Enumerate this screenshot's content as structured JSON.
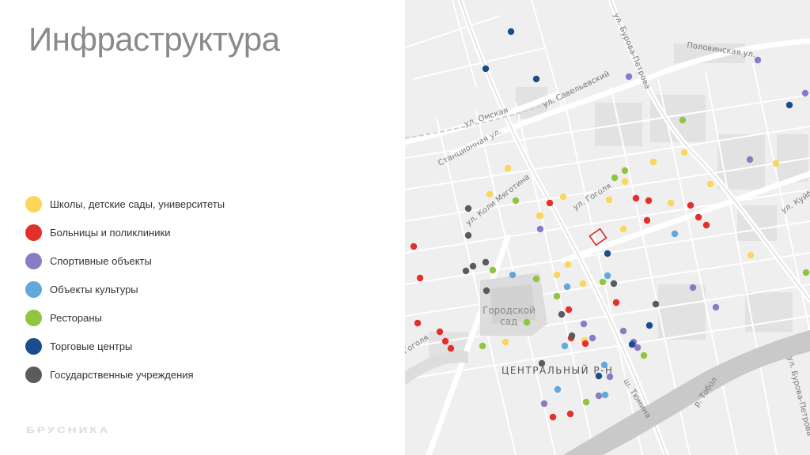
{
  "title": "Инфраструктура",
  "legend": [
    {
      "key": "school",
      "label": "Школы, детские сады, университеты",
      "color": "#fad75a"
    },
    {
      "key": "hospital",
      "label": "Больницы и поликлиники",
      "color": "#e2302b"
    },
    {
      "key": "sport",
      "label": "Спортивные объекты",
      "color": "#8a7cc4"
    },
    {
      "key": "culture",
      "label": "Объекты культуры",
      "color": "#62a8dc"
    },
    {
      "key": "restaurant",
      "label": "Рестораны",
      "color": "#8ec63f"
    },
    {
      "key": "mall",
      "label": "Торговые центры",
      "color": "#1a4c8e"
    },
    {
      "key": "gov",
      "label": "Государственные учреждения",
      "color": "#5b5b5b"
    }
  ],
  "brand": "БРУСНИКА",
  "map": {
    "streets": {
      "polovinskaya": "Половинская ул.",
      "burova_top": "ул. Бурова-Петрова",
      "saveleva": "ул. Савельевский",
      "omskaya": "ул. Омская",
      "stantsionnaya": "Станционная ул.",
      "gogolya": "ул. Гоголя",
      "koli_myagotina": "ул. Коли Мяготина",
      "kuib": "ул. Куйб",
      "gogolya_left": "Гоголя",
      "burova_bottom": "ул. Бурова-Петрова",
      "tobol": "р. Тобол",
      "tyumina": "ш. Тюмина"
    },
    "park": "Городской сад",
    "district": "ЦЕНТРАЛЬНЫЙ Р-Н",
    "markers": {
      "school": [
        [
          130,
          213
        ],
        [
          107,
          246
        ],
        [
          171,
          273
        ],
        [
          200,
          249
        ],
        [
          258,
          253
        ],
        [
          278,
          230
        ],
        [
          276,
          290
        ],
        [
          314,
          205
        ],
        [
          353,
          193
        ],
        [
          336,
          257
        ],
        [
          386,
          233
        ],
        [
          469,
          207
        ],
        [
          437,
          323
        ],
        [
          206,
          335
        ],
        [
          192,
          348
        ],
        [
          225,
          359
        ],
        [
          127,
          433
        ],
        [
          227,
          431
        ],
        [
          170,
          273
        ]
      ],
      "hospital": [
        [
          11,
          312
        ],
        [
          19,
          352
        ],
        [
          183,
          257
        ],
        [
          292,
          251
        ],
        [
          308,
          254
        ],
        [
          306,
          279
        ],
        [
          361,
          260
        ],
        [
          371,
          275
        ],
        [
          381,
          285
        ],
        [
          16,
          409
        ],
        [
          44,
          420
        ],
        [
          51,
          432
        ],
        [
          58,
          441
        ],
        [
          207,
          392
        ],
        [
          267,
          383
        ],
        [
          210,
          428
        ],
        [
          228,
          435
        ],
        [
          187,
          528
        ],
        [
          209,
          524
        ]
      ],
      "sport": [
        [
          283,
          97
        ],
        [
          446,
          76
        ],
        [
          506,
          118
        ],
        [
          436,
          202
        ],
        [
          171,
          290
        ],
        [
          237,
          428
        ],
        [
          276,
          419
        ],
        [
          294,
          440
        ],
        [
          364,
          364
        ],
        [
          393,
          389
        ],
        [
          226,
          410
        ],
        [
          289,
          433
        ],
        [
          259,
          477
        ],
        [
          176,
          511
        ],
        [
          245,
          501
        ]
      ],
      "culture": [
        [
          136,
          348
        ],
        [
          205,
          363
        ],
        [
          256,
          349
        ],
        [
          341,
          296
        ],
        [
          202,
          438
        ],
        [
          252,
          462
        ],
        [
          193,
          493
        ],
        [
          253,
          500
        ]
      ],
      "restaurant": [
        [
          351,
          152
        ],
        [
          278,
          216
        ],
        [
          265,
          225
        ],
        [
          140,
          254
        ],
        [
          111,
          342
        ],
        [
          166,
          353
        ],
        [
          192,
          375
        ],
        [
          250,
          357
        ],
        [
          154,
          408
        ],
        [
          98,
          438
        ],
        [
          302,
          450
        ],
        [
          229,
          509
        ],
        [
          507,
          345
        ]
      ],
      "mall": [
        [
          134,
          40
        ],
        [
          102,
          87
        ],
        [
          166,
          100
        ],
        [
          486,
          133
        ],
        [
          256,
          321
        ],
        [
          309,
          412
        ],
        [
          245,
          476
        ],
        [
          287,
          436
        ]
      ],
      "gov": [
        [
          80,
          264
        ],
        [
          80,
          298
        ],
        [
          77,
          343
        ],
        [
          86,
          337
        ],
        [
          102,
          332
        ],
        [
          103,
          368
        ],
        [
          264,
          359
        ],
        [
          317,
          385
        ],
        [
          198,
          398
        ],
        [
          211,
          425
        ],
        [
          173,
          460
        ]
      ]
    }
  }
}
